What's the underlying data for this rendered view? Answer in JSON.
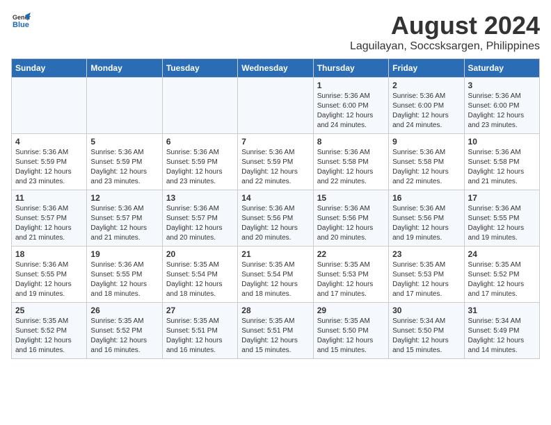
{
  "logo": {
    "general": "General",
    "blue": "Blue"
  },
  "title": "August 2024",
  "subtitle": "Laguilayan, Soccsksargen, Philippines",
  "headers": [
    "Sunday",
    "Monday",
    "Tuesday",
    "Wednesday",
    "Thursday",
    "Friday",
    "Saturday"
  ],
  "weeks": [
    [
      {
        "day": "",
        "sunrise": "",
        "sunset": "",
        "daylight": ""
      },
      {
        "day": "",
        "sunrise": "",
        "sunset": "",
        "daylight": ""
      },
      {
        "day": "",
        "sunrise": "",
        "sunset": "",
        "daylight": ""
      },
      {
        "day": "",
        "sunrise": "",
        "sunset": "",
        "daylight": ""
      },
      {
        "day": "1",
        "sunrise": "Sunrise: 5:36 AM",
        "sunset": "Sunset: 6:00 PM",
        "daylight": "Daylight: 12 hours and 24 minutes."
      },
      {
        "day": "2",
        "sunrise": "Sunrise: 5:36 AM",
        "sunset": "Sunset: 6:00 PM",
        "daylight": "Daylight: 12 hours and 24 minutes."
      },
      {
        "day": "3",
        "sunrise": "Sunrise: 5:36 AM",
        "sunset": "Sunset: 6:00 PM",
        "daylight": "Daylight: 12 hours and 23 minutes."
      }
    ],
    [
      {
        "day": "4",
        "sunrise": "Sunrise: 5:36 AM",
        "sunset": "Sunset: 5:59 PM",
        "daylight": "Daylight: 12 hours and 23 minutes."
      },
      {
        "day": "5",
        "sunrise": "Sunrise: 5:36 AM",
        "sunset": "Sunset: 5:59 PM",
        "daylight": "Daylight: 12 hours and 23 minutes."
      },
      {
        "day": "6",
        "sunrise": "Sunrise: 5:36 AM",
        "sunset": "Sunset: 5:59 PM",
        "daylight": "Daylight: 12 hours and 23 minutes."
      },
      {
        "day": "7",
        "sunrise": "Sunrise: 5:36 AM",
        "sunset": "Sunset: 5:59 PM",
        "daylight": "Daylight: 12 hours and 22 minutes."
      },
      {
        "day": "8",
        "sunrise": "Sunrise: 5:36 AM",
        "sunset": "Sunset: 5:58 PM",
        "daylight": "Daylight: 12 hours and 22 minutes."
      },
      {
        "day": "9",
        "sunrise": "Sunrise: 5:36 AM",
        "sunset": "Sunset: 5:58 PM",
        "daylight": "Daylight: 12 hours and 22 minutes."
      },
      {
        "day": "10",
        "sunrise": "Sunrise: 5:36 AM",
        "sunset": "Sunset: 5:58 PM",
        "daylight": "Daylight: 12 hours and 21 minutes."
      }
    ],
    [
      {
        "day": "11",
        "sunrise": "Sunrise: 5:36 AM",
        "sunset": "Sunset: 5:57 PM",
        "daylight": "Daylight: 12 hours and 21 minutes."
      },
      {
        "day": "12",
        "sunrise": "Sunrise: 5:36 AM",
        "sunset": "Sunset: 5:57 PM",
        "daylight": "Daylight: 12 hours and 21 minutes."
      },
      {
        "day": "13",
        "sunrise": "Sunrise: 5:36 AM",
        "sunset": "Sunset: 5:57 PM",
        "daylight": "Daylight: 12 hours and 20 minutes."
      },
      {
        "day": "14",
        "sunrise": "Sunrise: 5:36 AM",
        "sunset": "Sunset: 5:56 PM",
        "daylight": "Daylight: 12 hours and 20 minutes."
      },
      {
        "day": "15",
        "sunrise": "Sunrise: 5:36 AM",
        "sunset": "Sunset: 5:56 PM",
        "daylight": "Daylight: 12 hours and 20 minutes."
      },
      {
        "day": "16",
        "sunrise": "Sunrise: 5:36 AM",
        "sunset": "Sunset: 5:56 PM",
        "daylight": "Daylight: 12 hours and 19 minutes."
      },
      {
        "day": "17",
        "sunrise": "Sunrise: 5:36 AM",
        "sunset": "Sunset: 5:55 PM",
        "daylight": "Daylight: 12 hours and 19 minutes."
      }
    ],
    [
      {
        "day": "18",
        "sunrise": "Sunrise: 5:36 AM",
        "sunset": "Sunset: 5:55 PM",
        "daylight": "Daylight: 12 hours and 19 minutes."
      },
      {
        "day": "19",
        "sunrise": "Sunrise: 5:36 AM",
        "sunset": "Sunset: 5:55 PM",
        "daylight": "Daylight: 12 hours and 18 minutes."
      },
      {
        "day": "20",
        "sunrise": "Sunrise: 5:35 AM",
        "sunset": "Sunset: 5:54 PM",
        "daylight": "Daylight: 12 hours and 18 minutes."
      },
      {
        "day": "21",
        "sunrise": "Sunrise: 5:35 AM",
        "sunset": "Sunset: 5:54 PM",
        "daylight": "Daylight: 12 hours and 18 minutes."
      },
      {
        "day": "22",
        "sunrise": "Sunrise: 5:35 AM",
        "sunset": "Sunset: 5:53 PM",
        "daylight": "Daylight: 12 hours and 17 minutes."
      },
      {
        "day": "23",
        "sunrise": "Sunrise: 5:35 AM",
        "sunset": "Sunset: 5:53 PM",
        "daylight": "Daylight: 12 hours and 17 minutes."
      },
      {
        "day": "24",
        "sunrise": "Sunrise: 5:35 AM",
        "sunset": "Sunset: 5:52 PM",
        "daylight": "Daylight: 12 hours and 17 minutes."
      }
    ],
    [
      {
        "day": "25",
        "sunrise": "Sunrise: 5:35 AM",
        "sunset": "Sunset: 5:52 PM",
        "daylight": "Daylight: 12 hours and 16 minutes."
      },
      {
        "day": "26",
        "sunrise": "Sunrise: 5:35 AM",
        "sunset": "Sunset: 5:52 PM",
        "daylight": "Daylight: 12 hours and 16 minutes."
      },
      {
        "day": "27",
        "sunrise": "Sunrise: 5:35 AM",
        "sunset": "Sunset: 5:51 PM",
        "daylight": "Daylight: 12 hours and 16 minutes."
      },
      {
        "day": "28",
        "sunrise": "Sunrise: 5:35 AM",
        "sunset": "Sunset: 5:51 PM",
        "daylight": "Daylight: 12 hours and 15 minutes."
      },
      {
        "day": "29",
        "sunrise": "Sunrise: 5:35 AM",
        "sunset": "Sunset: 5:50 PM",
        "daylight": "Daylight: 12 hours and 15 minutes."
      },
      {
        "day": "30",
        "sunrise": "Sunrise: 5:34 AM",
        "sunset": "Sunset: 5:50 PM",
        "daylight": "Daylight: 12 hours and 15 minutes."
      },
      {
        "day": "31",
        "sunrise": "Sunrise: 5:34 AM",
        "sunset": "Sunset: 5:49 PM",
        "daylight": "Daylight: 12 hours and 14 minutes."
      }
    ]
  ]
}
